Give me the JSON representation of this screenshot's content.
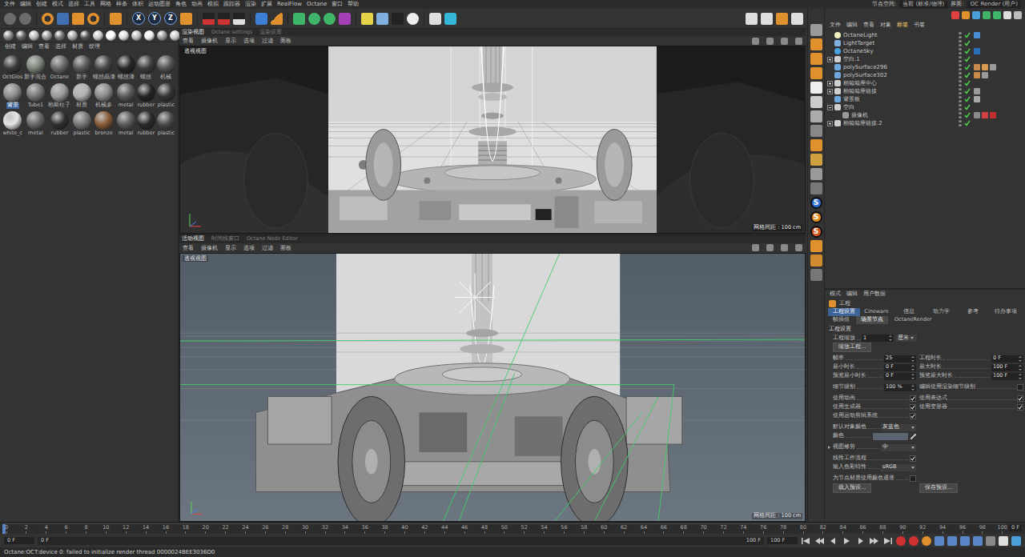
{
  "menubar": {
    "items": [
      "文件",
      "编辑",
      "创建",
      "模式",
      "选择",
      "工具",
      "网格",
      "样条",
      "体积",
      "运动图形",
      "角色",
      "动画",
      "模拟",
      "跟踪器",
      "渲染",
      "扩展",
      "RealFlow",
      "Octane",
      "窗口",
      "帮助"
    ],
    "right": [
      "节点空间:",
      "当前 (标准/物理)",
      "界面:",
      "OC Render (用户)"
    ]
  },
  "toolbar": {
    "axes": [
      "X",
      "Y",
      "Z"
    ]
  },
  "material_manager": {
    "menu": [
      "创建",
      "编辑",
      "查看",
      "选择",
      "材质",
      "纹理"
    ],
    "materials": [
      {
        "label": "OctGlos",
        "color": "#3a3a3a",
        "selected": false
      },
      {
        "label": "新手混合",
        "color": "#7a8478",
        "selected": false
      },
      {
        "label": "Octane",
        "color": "#6a6a6a",
        "selected": false
      },
      {
        "label": "新手",
        "color": "#585858",
        "selected": false
      },
      {
        "label": "螺丝晶漆",
        "color": "#464646",
        "selected": false
      },
      {
        "label": "螺丝漆",
        "color": "#262626",
        "selected": false
      },
      {
        "label": "螺丝",
        "color": "#3e3e3e",
        "selected": false
      },
      {
        "label": "机械",
        "color": "#525252",
        "selected": false
      },
      {
        "label": "背景",
        "color": "#8c8c8c",
        "selected": true
      },
      {
        "label": "Tube1",
        "color": "#777777",
        "selected": false
      },
      {
        "label": "柏斯柱子",
        "color": "#9a9a9a",
        "selected": false
      },
      {
        "label": "材质",
        "color": "#b0b0b0",
        "selected": false
      },
      {
        "label": "机械多",
        "color": "#8a8a8a",
        "selected": false
      },
      {
        "label": "metal",
        "color": "#5a5a5a",
        "selected": false
      },
      {
        "label": "rubber",
        "color": "#242424",
        "selected": false
      },
      {
        "label": "plastic",
        "color": "#353535",
        "selected": false
      },
      {
        "label": "white_c",
        "color": "#e6e6e6",
        "selected": false
      },
      {
        "label": "metal",
        "color": "#686868",
        "selected": false
      },
      {
        "label": "rubber",
        "color": "#303030",
        "selected": false
      },
      {
        "label": "plastic",
        "color": "#777777",
        "selected": false
      },
      {
        "label": "bronze",
        "color": "#8a5a35",
        "selected": false
      },
      {
        "label": "metal",
        "color": "#5c5c5c",
        "selected": false
      },
      {
        "label": "rubber",
        "color": "#2a2a2a",
        "selected": false
      },
      {
        "label": "plastic",
        "color": "#4a4a4a",
        "selected": false
      }
    ]
  },
  "viewport_top": {
    "tabs": [
      {
        "label": "渲染视图",
        "selected": true
      },
      {
        "label": "Octane settings",
        "selected": false
      },
      {
        "label": "渲染设置",
        "selected": false
      }
    ],
    "menu": [
      "查看",
      "摄像机",
      "显示",
      "选项",
      "过滤",
      "面板"
    ],
    "label": "透视视图",
    "grid": "网格间距 : 100 cm"
  },
  "panel_tabs": [
    {
      "label": "活动视图",
      "selected": true
    },
    {
      "label": "时间线窗口",
      "selected": false
    },
    {
      "label": "Octane Node Editor",
      "selected": false
    }
  ],
  "viewport_bottom": {
    "menu": [
      "查看",
      "摄像机",
      "显示",
      "选项",
      "过滤",
      "面板"
    ],
    "label": "透视视图",
    "grid": "网格间距 : 100 cm"
  },
  "side_toolbar": {
    "badges": [
      {
        "label": "S",
        "color": "#2f6fd6"
      },
      {
        "label": "S",
        "color": "#e08a1a"
      },
      {
        "label": "S",
        "color": "#d8541c"
      }
    ]
  },
  "object_manager": {
    "menu": [
      {
        "label": "文件",
        "selected": false
      },
      {
        "label": "编辑",
        "selected": false
      },
      {
        "label": "查看",
        "selected": false
      },
      {
        "label": "对象",
        "selected": false
      },
      {
        "label": "标签",
        "selected": true
      },
      {
        "label": "书签",
        "selected": false
      }
    ],
    "objects": [
      {
        "name": "OctaneLight",
        "kind": "light",
        "child": false,
        "has_children": false,
        "expanded": false,
        "enabled": true,
        "tags": [
          "#4a8fd6"
        ]
      },
      {
        "name": "LightTarget",
        "kind": "target",
        "child": false,
        "has_children": false,
        "expanded": false,
        "enabled": true,
        "tags": []
      },
      {
        "name": "OctaneSky",
        "kind": "sky",
        "child": false,
        "has_children": false,
        "expanded": false,
        "enabled": true,
        "tags": [
          "#2a6fb8"
        ]
      },
      {
        "name": "空白.1",
        "kind": "null",
        "child": false,
        "has_children": true,
        "expanded": false,
        "enabled": true,
        "tags": []
      },
      {
        "name": "polySurface296",
        "kind": "mesh",
        "child": false,
        "has_children": false,
        "expanded": false,
        "enabled": true,
        "tags": [
          "#c88a4a",
          "#d89a50",
          "#9a9a9a"
        ]
      },
      {
        "name": "polySurface302",
        "kind": "mesh",
        "child": false,
        "has_children": false,
        "expanded": false,
        "enabled": true,
        "tags": [
          "#c88a4a",
          "#9a9a9a"
        ]
      },
      {
        "name": "柏箱箱座中心",
        "kind": "null",
        "child": false,
        "has_children": true,
        "expanded": false,
        "enabled": true,
        "tags": []
      },
      {
        "name": "柏箱箱座链接",
        "kind": "null",
        "child": false,
        "has_children": true,
        "expanded": false,
        "enabled": true,
        "tags": [
          "#9a9a9a"
        ]
      },
      {
        "name": "背景板",
        "kind": "mesh",
        "child": false,
        "has_children": false,
        "expanded": false,
        "enabled": true,
        "tags": [
          "#a8a8a8"
        ]
      },
      {
        "name": "空白",
        "kind": "null",
        "child": false,
        "has_children": true,
        "expanded": true,
        "enabled": true,
        "tags": []
      },
      {
        "name": "摄像机",
        "kind": "camera",
        "child": true,
        "has_children": false,
        "expanded": false,
        "enabled": true,
        "tags": [
          "#8a8a8a",
          "#d04040",
          "#c03030"
        ]
      },
      {
        "name": "柏箱箱座链接.2",
        "kind": "null",
        "child": false,
        "has_children": true,
        "expanded": false,
        "enabled": true,
        "tags": []
      }
    ]
  },
  "attributes": {
    "menu": [
      "模式",
      "编辑",
      "用户数据"
    ],
    "title": "工程",
    "tabs": [
      {
        "label": "工程设置",
        "selected": true
      },
      {
        "label": "Cineware",
        "selected": false
      },
      {
        "label": "信息",
        "selected": false
      },
      {
        "label": "动力学",
        "selected": false
      },
      {
        "label": "参考",
        "selected": false
      },
      {
        "label": "待办事项",
        "selected": false
      }
    ],
    "subtabs": [
      {
        "label": "帧插值",
        "selected": false
      },
      {
        "label": "场景节点",
        "selected": true
      },
      {
        "label": "OctaneRender",
        "selected": false
      }
    ],
    "section": "工程设置",
    "groups": [
      [
        [
          {
            "kind": "number-unit",
            "label": "工程缩放",
            "value": "1",
            "unit": "厘米"
          }
        ],
        [
          {
            "kind": "button",
            "value": "缩放工程..."
          }
        ]
      ],
      [
        [
          {
            "kind": "number",
            "label": "帧率",
            "value": "25"
          },
          {
            "kind": "number",
            "label": "工程时长",
            "value": "0 F"
          }
        ],
        [
          {
            "kind": "number",
            "label": "最小时长",
            "value": "0 F"
          },
          {
            "kind": "number",
            "label": "最大时长",
            "value": "100 F"
          }
        ],
        [
          {
            "kind": "number",
            "label": "预览最小时长",
            "value": "0 F"
          },
          {
            "kind": "number",
            "label": "预览最大时长",
            "value": "100 F"
          }
        ]
      ],
      [
        [
          {
            "kind": "number",
            "label": "细节级别",
            "value": "100 %"
          },
          {
            "kind": "check",
            "label": "编辑使用渲染细节级别",
            "checked": false
          }
        ]
      ],
      [
        [
          {
            "kind": "check",
            "label": "使用动画",
            "checked": true
          },
          {
            "kind": "check",
            "label": "使用表达式",
            "checked": true
          }
        ],
        [
          {
            "kind": "check",
            "label": "使用生成器",
            "checked": true
          },
          {
            "kind": "check",
            "label": "使用变形器",
            "checked": true
          }
        ],
        [
          {
            "kind": "check",
            "label": "使用运动剪辑系统",
            "checked": true
          }
        ]
      ],
      [
        [
          {
            "kind": "dropdown",
            "label": "默认对象颜色",
            "value": "灰蓝色"
          }
        ],
        [
          {
            "kind": "color",
            "label": "颜色"
          }
        ]
      ],
      [
        [
          {
            "kind": "dropdown-collapsed",
            "label": "视图修剪",
            "value": "中"
          }
        ]
      ],
      [
        [
          {
            "kind": "check",
            "label": "线性工作流程",
            "checked": true
          }
        ],
        [
          {
            "kind": "dropdown",
            "label": "输入色彩特性",
            "value": "sRGB"
          }
        ]
      ],
      [
        [
          {
            "kind": "check",
            "label": "为节点材质使用颜色通道",
            "checked": false
          }
        ],
        [
          {
            "kind": "button",
            "value": "载入预设..."
          },
          {
            "kind": "button",
            "value": "保存预设..."
          }
        ]
      ]
    ]
  },
  "timeline": {
    "ticks": [
      "0",
      "2",
      "4",
      "6",
      "8",
      "10",
      "12",
      "14",
      "16",
      "18",
      "20",
      "22",
      "24",
      "26",
      "28",
      "30",
      "32",
      "34",
      "36",
      "38",
      "40",
      "42",
      "44",
      "46",
      "48",
      "50",
      "52",
      "54",
      "56",
      "58",
      "60",
      "62",
      "64",
      "66",
      "68",
      "70",
      "72",
      "74",
      "76",
      "78",
      "80",
      "82",
      "84",
      "86",
      "88",
      "90",
      "92",
      "94",
      "96",
      "98",
      "100"
    ],
    "end": "0 F"
  },
  "transport": {
    "start": "0 F",
    "current": "0 F",
    "end": "100 F",
    "max": "100 F"
  },
  "status_bar": "Octane:OCT:device 0: failed to initialize render thread 0000024BEE3036D0"
}
